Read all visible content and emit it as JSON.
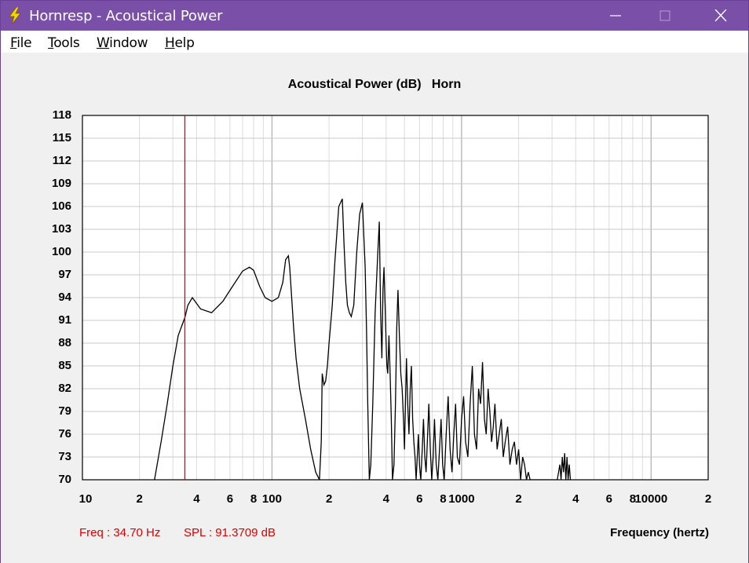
{
  "window": {
    "title": "Hornresp - Acoustical Power",
    "icon": "lightning-bolt-icon",
    "controls": [
      "minimize-icon",
      "maximize-icon",
      "close-icon"
    ]
  },
  "menu": {
    "items": [
      {
        "label": "File"
      },
      {
        "label": "Tools"
      },
      {
        "label": "Window"
      },
      {
        "label": "Help"
      }
    ]
  },
  "readout": {
    "freq": "Freq : 34.70 Hz",
    "spl": "SPL : 91.3709 dB"
  },
  "colors": {
    "titlebar": "#7a4fa8",
    "curve": "#000000",
    "marker": "#e00000",
    "grid": "#c8c8c8"
  },
  "chart_data": {
    "type": "line",
    "title": "Acoustical Power (dB)   Horn",
    "xlabel": "Frequency (hertz)",
    "ylabel": "",
    "x_scale": "log",
    "xlim": [
      10,
      20000
    ],
    "ylim": [
      70,
      118
    ],
    "yticks": [
      "118",
      "115",
      "112",
      "109",
      "106",
      "103",
      "100",
      "97",
      "94",
      "91",
      "88",
      "85",
      "82",
      "79",
      "76",
      "73",
      "70"
    ],
    "xticks": [
      {
        "v": 10,
        "label": "10"
      },
      {
        "v": 20,
        "label": "2"
      },
      {
        "v": 40,
        "label": "4"
      },
      {
        "v": 60,
        "label": "6"
      },
      {
        "v": 80,
        "label": "8"
      },
      {
        "v": 100,
        "label": "100"
      },
      {
        "v": 200,
        "label": "2"
      },
      {
        "v": 400,
        "label": "4"
      },
      {
        "v": 600,
        "label": "6"
      },
      {
        "v": 800,
        "label": "8"
      },
      {
        "v": 1000,
        "label": "1000"
      },
      {
        "v": 2000,
        "label": "2"
      },
      {
        "v": 4000,
        "label": "4"
      },
      {
        "v": 6000,
        "label": "6"
      },
      {
        "v": 8000,
        "label": "8"
      },
      {
        "v": 10000,
        "label": "10000"
      },
      {
        "v": 20000,
        "label": "2"
      }
    ],
    "grid": true,
    "marker_x": 34.7,
    "series": [
      {
        "x": [
          24,
          26,
          28,
          30,
          32,
          34.7,
          36,
          38,
          42,
          48,
          55,
          62,
          70,
          76,
          80,
          86,
          92,
          100,
          108,
          114,
          118,
          122,
          124,
          127,
          130,
          134,
          140,
          150,
          160,
          170,
          178,
          182,
          184,
          188,
          192,
          196,
          200,
          208,
          215,
          225,
          235,
          240,
          245,
          250,
          256,
          262,
          270,
          280,
          290,
          300,
          310,
          315,
          320,
          326,
          332,
          340,
          350,
          360,
          368,
          374,
          380,
          385,
          390,
          395,
          400,
          404,
          408,
          414,
          420,
          426,
          432,
          440,
          448,
          455,
          462,
          470,
          478,
          486,
          494,
          500,
          506,
          512,
          520,
          528,
          536,
          544,
          552,
          560,
          568,
          576,
          584,
          592,
          600,
          610,
          620,
          630,
          640,
          650,
          660,
          672,
          684,
          696,
          708,
          720,
          735,
          750,
          765,
          780,
          795,
          810,
          830,
          850,
          870,
          890,
          910,
          930,
          950,
          975,
          1000,
          1025,
          1050,
          1080,
          1110,
          1140,
          1170,
          1200,
          1230,
          1260,
          1290,
          1320,
          1350,
          1380,
          1410,
          1440,
          1470,
          1500,
          1540,
          1580,
          1620,
          1660,
          1700,
          1750,
          1800,
          1850,
          1900,
          1950,
          2000,
          2050,
          2100,
          2150,
          2200,
          2250,
          2300,
          2350,
          2400,
          2450,
          2500,
          2550,
          2600,
          2650,
          2700,
          2750,
          2800,
          2850,
          2900,
          2950,
          3000,
          3100,
          3200,
          3300,
          3350,
          3400,
          3450,
          3500,
          3550,
          3600,
          3650,
          3700,
          3750,
          3800
        ],
        "y": [
          70,
          75,
          80,
          85,
          89,
          91.37,
          93,
          94,
          92.5,
          92,
          93.5,
          95.5,
          97.5,
          98,
          97.6,
          95.5,
          94,
          93.5,
          94,
          96,
          99,
          99.5,
          98,
          94,
          90,
          86,
          82,
          78,
          74,
          71,
          70,
          75,
          84,
          82.5,
          83,
          85,
          88,
          93,
          99,
          106,
          107,
          101,
          96,
          93,
          92,
          91.5,
          93,
          100,
          105,
          106.5,
          98,
          90,
          80,
          70,
          72,
          80,
          92,
          99,
          104,
          92,
          86,
          95,
          98,
          93,
          88,
          85,
          84,
          89,
          84,
          78,
          70,
          72,
          80,
          90,
          95,
          89,
          84,
          82,
          78,
          74,
          80,
          86,
          80,
          76,
          82,
          85,
          78,
          75,
          73,
          70,
          73,
          76,
          72,
          70,
          74,
          78,
          73,
          71,
          75,
          80,
          74,
          70,
          73,
          78,
          72,
          70,
          74,
          78,
          72,
          70,
          76,
          81,
          74,
          71,
          76,
          80,
          73,
          72,
          78,
          81,
          75,
          73,
          80,
          85,
          76,
          74,
          82,
          80,
          85.5,
          78,
          76,
          82,
          79,
          75,
          77,
          80,
          74,
          76,
          78,
          73,
          75,
          77,
          72,
          74,
          75,
          72,
          74,
          70,
          73,
          72,
          70,
          71,
          70,
          70,
          70,
          70,
          70,
          70,
          70,
          70,
          70,
          70,
          70,
          70,
          70,
          70,
          70,
          70,
          70,
          72,
          70,
          73,
          71,
          73.5,
          70,
          73,
          70,
          72,
          70,
          70
        ]
      }
    ]
  }
}
